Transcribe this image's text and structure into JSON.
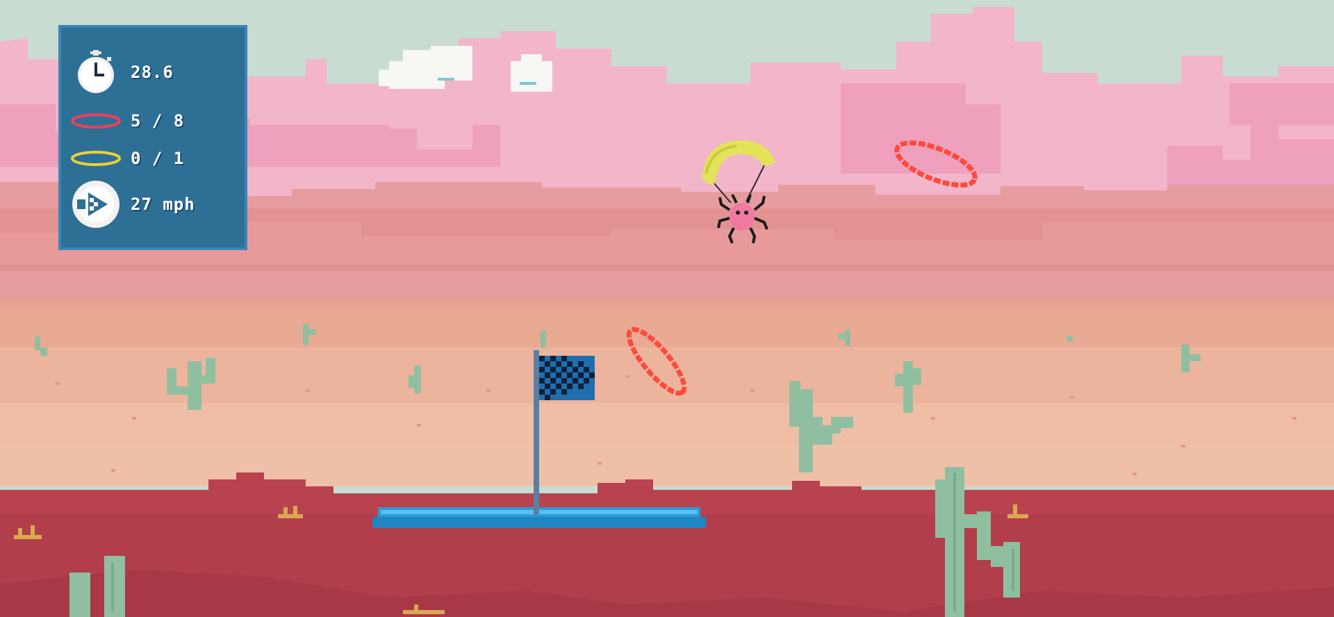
{
  "hud": {
    "timer": {
      "icon": "stopwatch-icon",
      "value": "28.6"
    },
    "red_rings": {
      "icon": "red-ring-icon",
      "value": "5 / 8"
    },
    "gold_rings": {
      "icon": "gold-ring-icon",
      "value": "0 / 1"
    },
    "speed": {
      "icon": "speed-gauge-icon",
      "value": "27 mph"
    }
  },
  "colors": {
    "sky": "#c9dcd2",
    "cloud_pink": "#f2b3c8",
    "mesa": "#e49a9a",
    "sand_light": "#f0c0a8",
    "ground_red": "#b8424e",
    "hud_bg": "#2e6f96",
    "hud_border": "#3b86b8",
    "ring_red": "#ff4a3a",
    "cactus": "#8fbfa0",
    "platform": "#2b9bd8"
  }
}
